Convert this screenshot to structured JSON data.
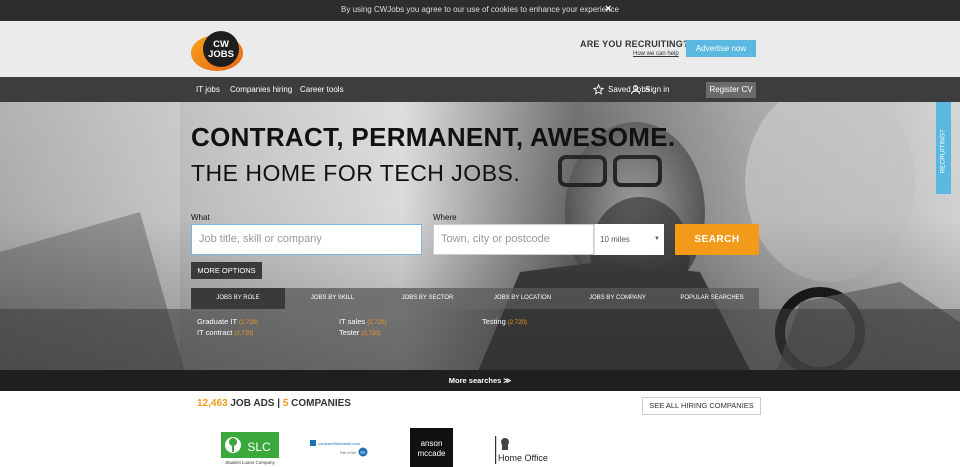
{
  "cookie_bar": {
    "text": "By using CWJobs you agree to our use of cookies to enhance your experience",
    "close_label": "×"
  },
  "header": {
    "logo": {
      "line1": "CW",
      "line2": "JOBS"
    },
    "recruiting_title": "ARE YOU RECRUITING?",
    "recruiting_link": "How we can help",
    "advertise_button": "Advertise now"
  },
  "nav": {
    "items": [
      "IT jobs",
      "Companies hiring",
      "Career tools"
    ],
    "saved_jobs": "Saved Jobs",
    "sign_in": "Sign in",
    "register": "Register CV"
  },
  "hero": {
    "headline": "CONTRACT, PERMANENT, AWESOME.",
    "subheadline": "THE HOME FOR TECH JOBS."
  },
  "search": {
    "what_label": "What",
    "what_placeholder": "Job title, skill or company",
    "where_label": "Where",
    "where_placeholder": "Town, city or postcode",
    "radius_value": "10 miles",
    "search_button": "SEARCH",
    "more_options": "MORE OPTIONS"
  },
  "tabs": [
    "JOBS BY ROLE",
    "JOBS BY SKILL",
    "JOBS BY SECTOR",
    "JOBS BY LOCATION",
    "JOBS BY COMPANY",
    "POPULAR SEARCHES"
  ],
  "role_links": [
    {
      "label": "Graduate IT",
      "count": "(2,720)"
    },
    {
      "label": "IT contract",
      "count": "(2,720)"
    },
    {
      "label": "IT sales",
      "count": "(2,720)"
    },
    {
      "label": "Tester",
      "count": "(2,720)"
    },
    {
      "label": "Testing",
      "count": "(2,720)"
    }
  ],
  "side_tab": "RECRUITING?",
  "more_searches": "More searches  ≫",
  "stats": {
    "job_ads_count": "12,463",
    "job_ads_label": " JOB ADS | ",
    "companies_count": "5",
    "companies_label": " COMPANIES"
  },
  "see_all_button": "SEE ALL HIRING COMPANIES",
  "company_logos": {
    "slc": {
      "mark": "SLC",
      "caption": "Student Loans Company"
    },
    "ccm": {
      "name": "comparethemarket.com",
      "tagline": "Part of the",
      "badge": "BG"
    },
    "anson": {
      "line1": "anson",
      "line2": "mccade"
    },
    "home_office": {
      "name": "Home Office"
    }
  },
  "colors": {
    "accent": "#f39a1a",
    "blue": "#5bb8e0",
    "dark": "#3d3d3d"
  }
}
